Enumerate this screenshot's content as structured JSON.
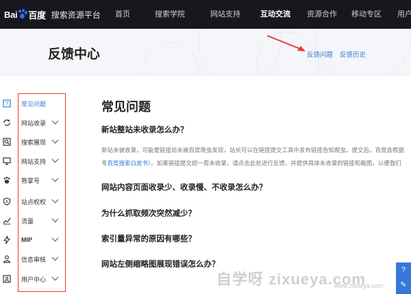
{
  "brand": {
    "logo_left": "Bai",
    "logo_right": "百度",
    "subtitle": "搜索资源平台",
    "brand_color": "#2e6bff"
  },
  "nav": {
    "items": [
      {
        "label": "首页",
        "active": false
      },
      {
        "label": "搜索学院",
        "active": false
      },
      {
        "label": "网站支持",
        "active": false
      },
      {
        "label": "互动交流",
        "active": true
      },
      {
        "label": "资源合作",
        "active": false
      },
      {
        "label": "移动专区",
        "active": false
      },
      {
        "label": "用户中心",
        "active": false
      }
    ]
  },
  "header": {
    "title": "反馈中心",
    "links": [
      "反馈问题",
      "反馈历史"
    ]
  },
  "sidebar": {
    "items": [
      {
        "label": "常见问题",
        "icon": "question-icon",
        "active": true
      },
      {
        "label": "网站收录",
        "icon": "recycle-icon",
        "active": false
      },
      {
        "label": "搜索展现",
        "icon": "search-display-icon",
        "active": false
      },
      {
        "label": "网站支持",
        "icon": "monitor-icon",
        "active": false
      },
      {
        "label": "熊掌号",
        "icon": "paw-icon",
        "active": false
      },
      {
        "label": "站点权权",
        "icon": "shield-icon",
        "active": false
      },
      {
        "label": "流量",
        "icon": "chart-icon",
        "active": false
      },
      {
        "label": "MIP",
        "icon": "lightning-icon",
        "active": false
      },
      {
        "label": "信息审核",
        "icon": "person-icon",
        "active": false
      },
      {
        "label": "用户中心",
        "icon": "profile-card-icon",
        "active": false
      }
    ]
  },
  "main": {
    "title": "常见问题",
    "questions": [
      "新站整站未收录怎么办？",
      "网站内容页面收录少、收录慢、不收录怎么办？",
      "为什么抓取频次突然减少？",
      "索引量异常的原因有哪些？",
      "网站左侧缩略图展现错误怎么办？"
    ],
    "answer_line1": "新站未被收录，可能是链接尚未被百度爬虫发现，站长可以在链接提交工具中发布链接告知爬虫。提交后，百度会根据",
    "answer_line2_prefix": "考",
    "answer_line2_link": "百度搜索白皮书",
    "answer_line2_suffix": "）。如果链接提交超一周未收录，请点击此处进行反馈，并提供具体未收录的链接和截图，以便我们"
  },
  "watermark": {
    "text": "自学呀 zixueya.com",
    "sub": "www.zixueya.com"
  },
  "colors": {
    "nav_bg": "#17181d",
    "accent": "#3a78d8",
    "highlight_box": "#e53935",
    "band_bg": "#f4f6f9"
  }
}
